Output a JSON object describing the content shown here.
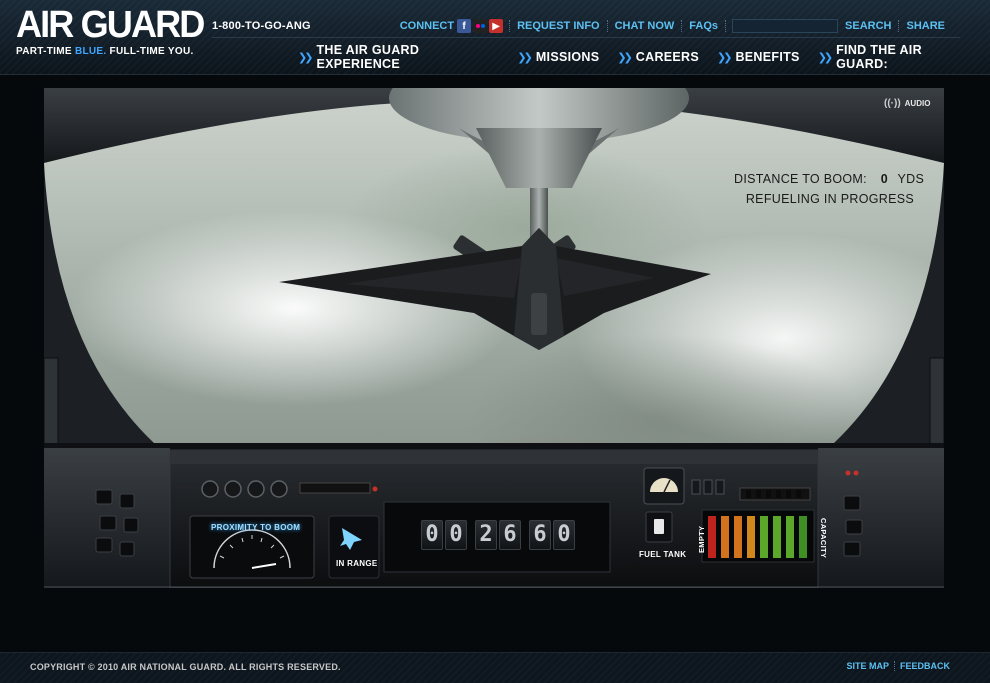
{
  "header": {
    "logo": "AIR GUARD",
    "tagline_part1": "PART-TIME",
    "tagline_highlight": "BLUE.",
    "tagline_part2": "FULL-TIME YOU.",
    "phone": "1-800-TO-GO-ANG",
    "utility": {
      "connect": "CONNECT",
      "request_info": "REQUEST INFO",
      "chat_now": "CHAT NOW",
      "faqs": "FAQs",
      "search_placeholder": "",
      "search_button": "SEARCH",
      "share": "SHARE"
    },
    "nav": [
      {
        "label": "THE AIR GUARD EXPERIENCE"
      },
      {
        "label": "MISSIONS"
      },
      {
        "label": "CAREERS"
      },
      {
        "label": "BENEFITS"
      },
      {
        "label": "FIND THE AIR GUARD:"
      }
    ]
  },
  "stage": {
    "audio_label": "AUDIO",
    "hud": {
      "distance_label": "DISTANCE TO BOOM:",
      "distance_value": "0",
      "distance_unit": "YDS",
      "status": "REFUELING IN PROGRESS"
    },
    "console": {
      "proximity_label": "PROXIMITY TO BOOM",
      "range_label": "IN RANGE",
      "timer": [
        "0",
        "0",
        "2",
        "6",
        "6",
        "0"
      ],
      "fuel_label": "FUEL TANK",
      "empty_label": "EMPTY",
      "capacity_label": "CAPACITY",
      "fuel_bars": [
        "#c0231b",
        "#d2721c",
        "#d2721c",
        "#d2891c",
        "#5aa72a",
        "#5aa72a",
        "#5aa72a",
        "#3f8f24"
      ],
      "fuel_level": 1.0
    }
  },
  "footer": {
    "copyright": "COPYRIGHT © 2010 AIR NATIONAL GUARD. ALL RIGHTS RESERVED.",
    "site_map": "SITE MAP",
    "feedback": "FEEDBACK"
  },
  "colors": {
    "accent": "#3ea6ff",
    "link": "#5cc0f2",
    "header_bg": "#14212c"
  }
}
